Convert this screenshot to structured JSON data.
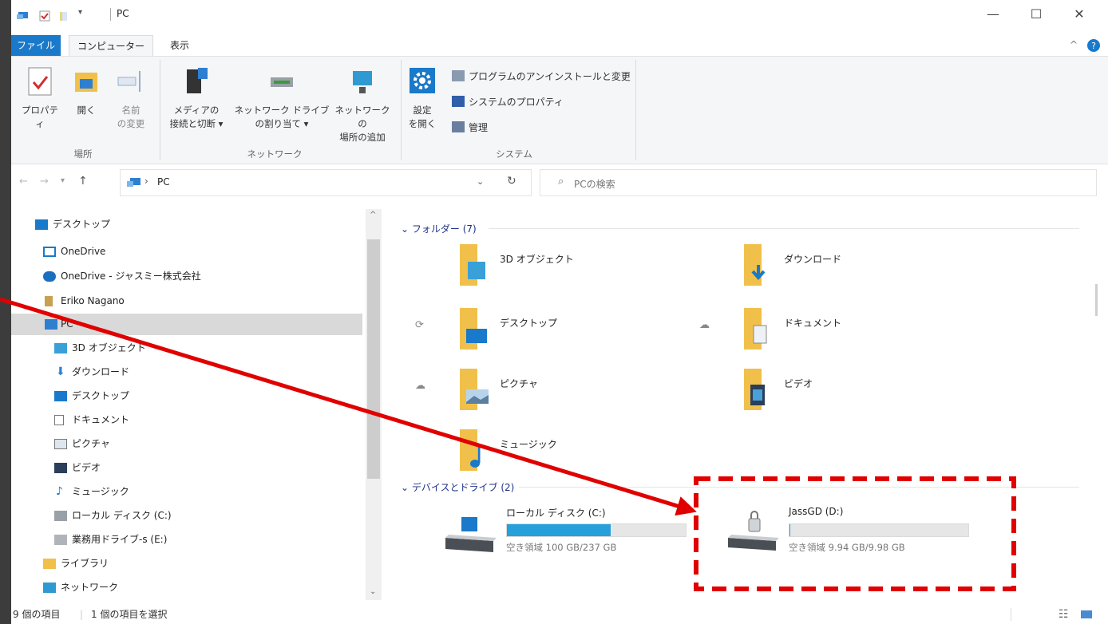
{
  "window": {
    "title": "PC",
    "minimize": "—",
    "maximize": "☐",
    "close": "✕"
  },
  "ribbon_tabs": [
    {
      "label": "ファイル"
    },
    {
      "label": "コンピューター"
    },
    {
      "label": "表示"
    }
  ],
  "ribbon": {
    "location": {
      "properties": "プロパティ",
      "open": "開く",
      "rename_1": "名前",
      "rename_2": "の変更",
      "label": "場所"
    },
    "network": {
      "media_1": "メディアの",
      "media_2": "接続と切断 ▾",
      "map_1": "ネットワーク ドライブ",
      "map_2": "の割り当て ▾",
      "addloc_1": "ネットワークの",
      "addloc_2": "場所の追加",
      "label": "ネットワーク"
    },
    "system": {
      "settings_1": "設定",
      "settings_2": "を開く",
      "uninstall": "プログラムのアンインストールと変更",
      "sysprops": "システムのプロパティ",
      "manage": "管理",
      "label": "システム"
    }
  },
  "address": {
    "path_sep": "›",
    "path": "PC",
    "search_placeholder": "PCの検索"
  },
  "nav": {
    "items": [
      {
        "label": "デスクトップ"
      },
      {
        "label": "OneDrive"
      },
      {
        "label": "OneDrive - ジャスミー株式会社"
      },
      {
        "label": "Eriko Nagano"
      },
      {
        "label": "PC"
      },
      {
        "label": "3D オブジェクト"
      },
      {
        "label": "ダウンロード"
      },
      {
        "label": "デスクトップ"
      },
      {
        "label": "ドキュメント"
      },
      {
        "label": "ピクチャ"
      },
      {
        "label": "ビデオ"
      },
      {
        "label": "ミュージック"
      },
      {
        "label": "ローカル ディスク (C:)"
      },
      {
        "label": "業務用ドライブ-s (E:)"
      },
      {
        "label": "ライブラリ"
      },
      {
        "label": "ネットワーク"
      }
    ]
  },
  "main": {
    "folders_header": "フォルダー (7)",
    "folders": [
      {
        "name": "3D オブジェクト"
      },
      {
        "name": "ダウンロード"
      },
      {
        "name": "デスクトップ"
      },
      {
        "name": "ドキュメント"
      },
      {
        "name": "ピクチャ"
      },
      {
        "name": "ビデオ"
      },
      {
        "name": "ミュージック"
      }
    ],
    "drives_header": "デバイスとドライブ (2)",
    "drives": [
      {
        "name": "ローカル ディスク (C:)",
        "free": "空き領域 100 GB/237 GB",
        "used_fraction": 0.58
      },
      {
        "name": "JassGD (D:)",
        "free": "空き領域 9.94 GB/9.98 GB",
        "used_fraction": 0.004
      }
    ]
  },
  "status": {
    "count": "9 個の項目",
    "selected": "1 個の項目を選択"
  },
  "colors": {
    "accent": "#1979ca",
    "folder": "#f0c04a",
    "annotation": "#e00000"
  }
}
